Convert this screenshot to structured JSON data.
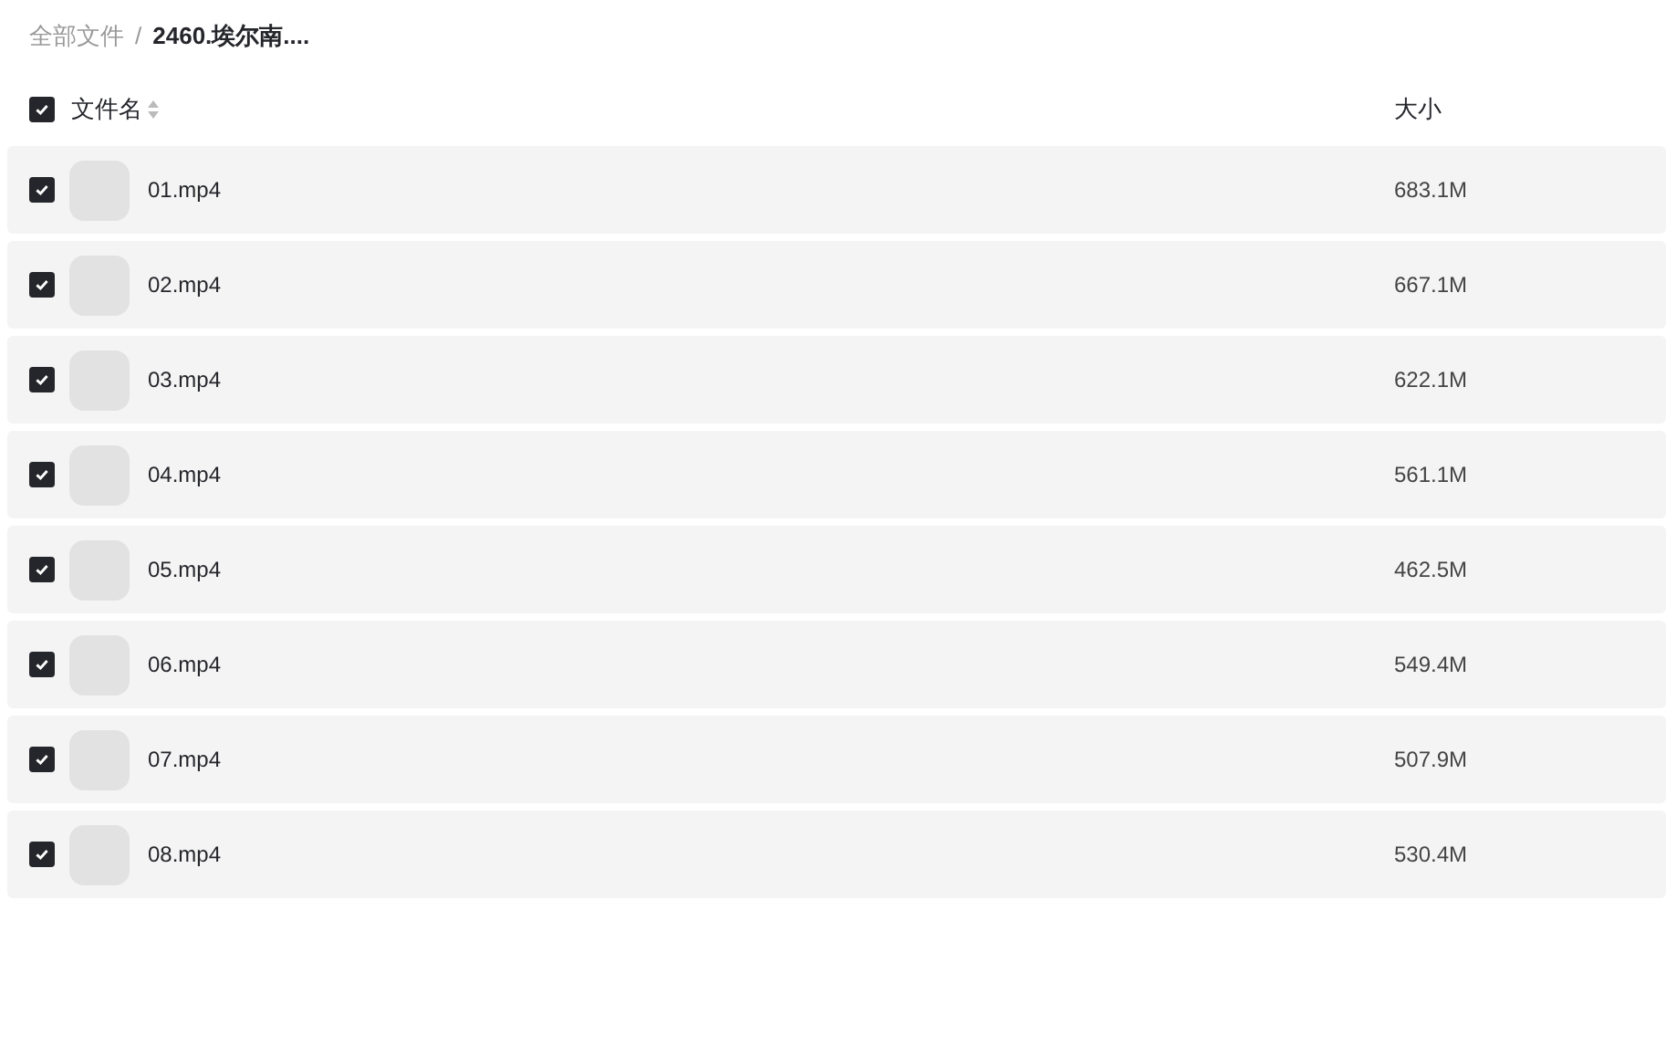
{
  "breadcrumb": [
    {
      "label": "全部文件",
      "current": false
    },
    {
      "label": "2460.埃尔南....",
      "current": true
    }
  ],
  "breadcrumb_separator": "/",
  "header": {
    "checked": true,
    "name_label": "文件名",
    "size_label": "大小"
  },
  "files": [
    {
      "name": "01.mp4",
      "size": "683.1M",
      "checked": true
    },
    {
      "name": "02.mp4",
      "size": "667.1M",
      "checked": true
    },
    {
      "name": "03.mp4",
      "size": "622.1M",
      "checked": true
    },
    {
      "name": "04.mp4",
      "size": "561.1M",
      "checked": true
    },
    {
      "name": "05.mp4",
      "size": "462.5M",
      "checked": true
    },
    {
      "name": "06.mp4",
      "size": "549.4M",
      "checked": true
    },
    {
      "name": "07.mp4",
      "size": "507.9M",
      "checked": true
    },
    {
      "name": "08.mp4",
      "size": "530.4M",
      "checked": true
    }
  ]
}
